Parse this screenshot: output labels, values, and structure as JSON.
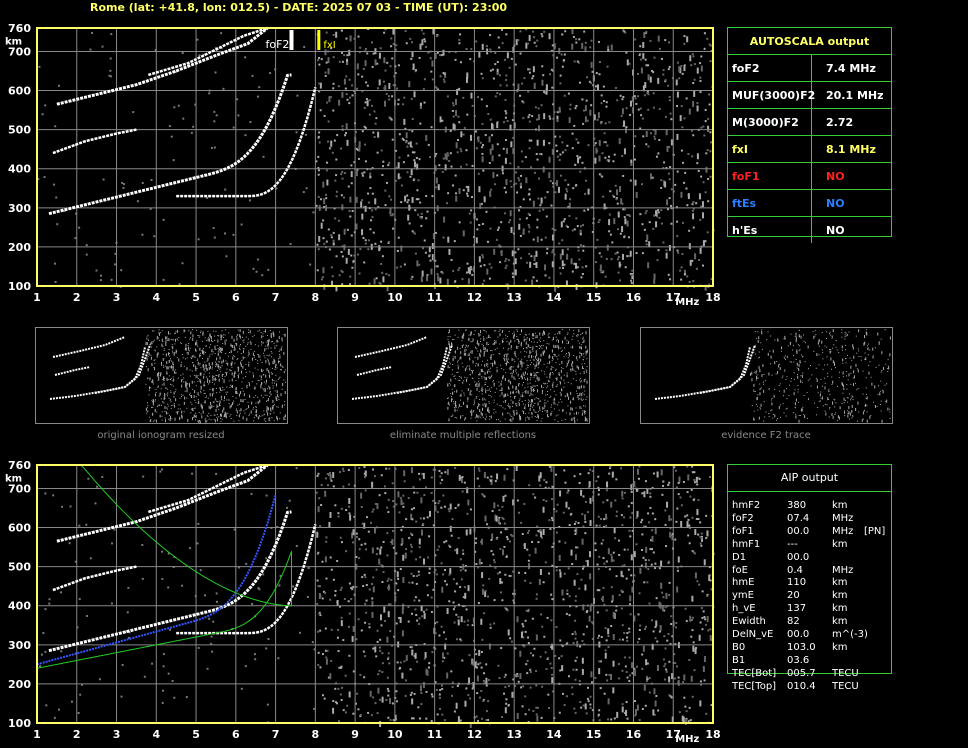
{
  "header": "Rome (lat: +41.8, lon: 012.5) - DATE: 2025 07 03 - TIME (UT): 23:00",
  "axes": {
    "y_ticks": [
      "760",
      "700",
      "600",
      "500",
      "400",
      "300",
      "200",
      "100"
    ],
    "y_unit": "km",
    "x_ticks": [
      "1",
      "2",
      "3",
      "4",
      "5",
      "6",
      "7",
      "8",
      "9",
      "10",
      "11",
      "12",
      "13",
      "14",
      "15",
      "16",
      "17",
      "18"
    ],
    "x_unit": "MHz"
  },
  "markers": {
    "foF2": "foF2",
    "fxI": "fxI"
  },
  "autoscala": {
    "title": "AUTOSCALA output",
    "rows": [
      {
        "name": "foF2",
        "value": "7.4 MHz",
        "color": "#ffffff"
      },
      {
        "name": "MUF(3000)F2",
        "value": "20.1 MHz",
        "color": "#ffffff"
      },
      {
        "name": "M(3000)F2",
        "value": "2.72",
        "color": "#ffffff"
      },
      {
        "name": "fxI",
        "value": "8.1 MHz",
        "color": "#ffff66"
      },
      {
        "name": "foF1",
        "value": "NO",
        "color": "#ff2020"
      },
      {
        "name": "ftEs",
        "value": "NO",
        "color": "#2a7fff"
      },
      {
        "name": "h'Es",
        "value": "NO",
        "color": "#ffffff"
      }
    ]
  },
  "thumbnails": [
    {
      "label": "original ionogram resized"
    },
    {
      "label": "eliminate multiple reflections"
    },
    {
      "label": "evidence F2 trace"
    }
  ],
  "aip": {
    "title": "AIP output",
    "rows": [
      {
        "name": "hmF2",
        "value": "380",
        "unit": "km",
        "extra": ""
      },
      {
        "name": "foF2",
        "value": "07.4",
        "unit": "MHz",
        "extra": ""
      },
      {
        "name": "foF1",
        "value": "00.0",
        "unit": "MHz",
        "extra": "[PN]"
      },
      {
        "name": "hmF1",
        "value": "---",
        "unit": "km",
        "extra": ""
      },
      {
        "name": "D1",
        "value": "00.0",
        "unit": "",
        "extra": ""
      },
      {
        "name": "foE",
        "value": "0.4",
        "unit": "MHz",
        "extra": ""
      },
      {
        "name": "hmE",
        "value": "110",
        "unit": "km",
        "extra": ""
      },
      {
        "name": "ymE",
        "value": "20",
        "unit": "km",
        "extra": ""
      },
      {
        "name": "h_vE",
        "value": "137",
        "unit": "km",
        "extra": ""
      },
      {
        "name": "Ewidth",
        "value": "82",
        "unit": "km",
        "extra": ""
      },
      {
        "name": "DelN_vE",
        "value": "00.0",
        "unit": "m^(-3)",
        "extra": ""
      },
      {
        "name": "B0",
        "value": "103.0",
        "unit": "km",
        "extra": ""
      },
      {
        "name": "B1",
        "value": "03.6",
        "unit": "",
        "extra": ""
      },
      {
        "name": "TEC[Bot]",
        "value": "005.7",
        "unit": "TECU",
        "extra": ""
      },
      {
        "name": "TEC[Top]",
        "value": "010.4",
        "unit": "TECU",
        "extra": ""
      }
    ]
  },
  "colors": {
    "axis": "#ffff66",
    "grid": "#888888",
    "table_border": "#33cc33",
    "trace": "#ffffff",
    "profile_blue": "#3355ff",
    "profile_green": "#22cc22",
    "marker_yellow": "#ffff00"
  }
}
